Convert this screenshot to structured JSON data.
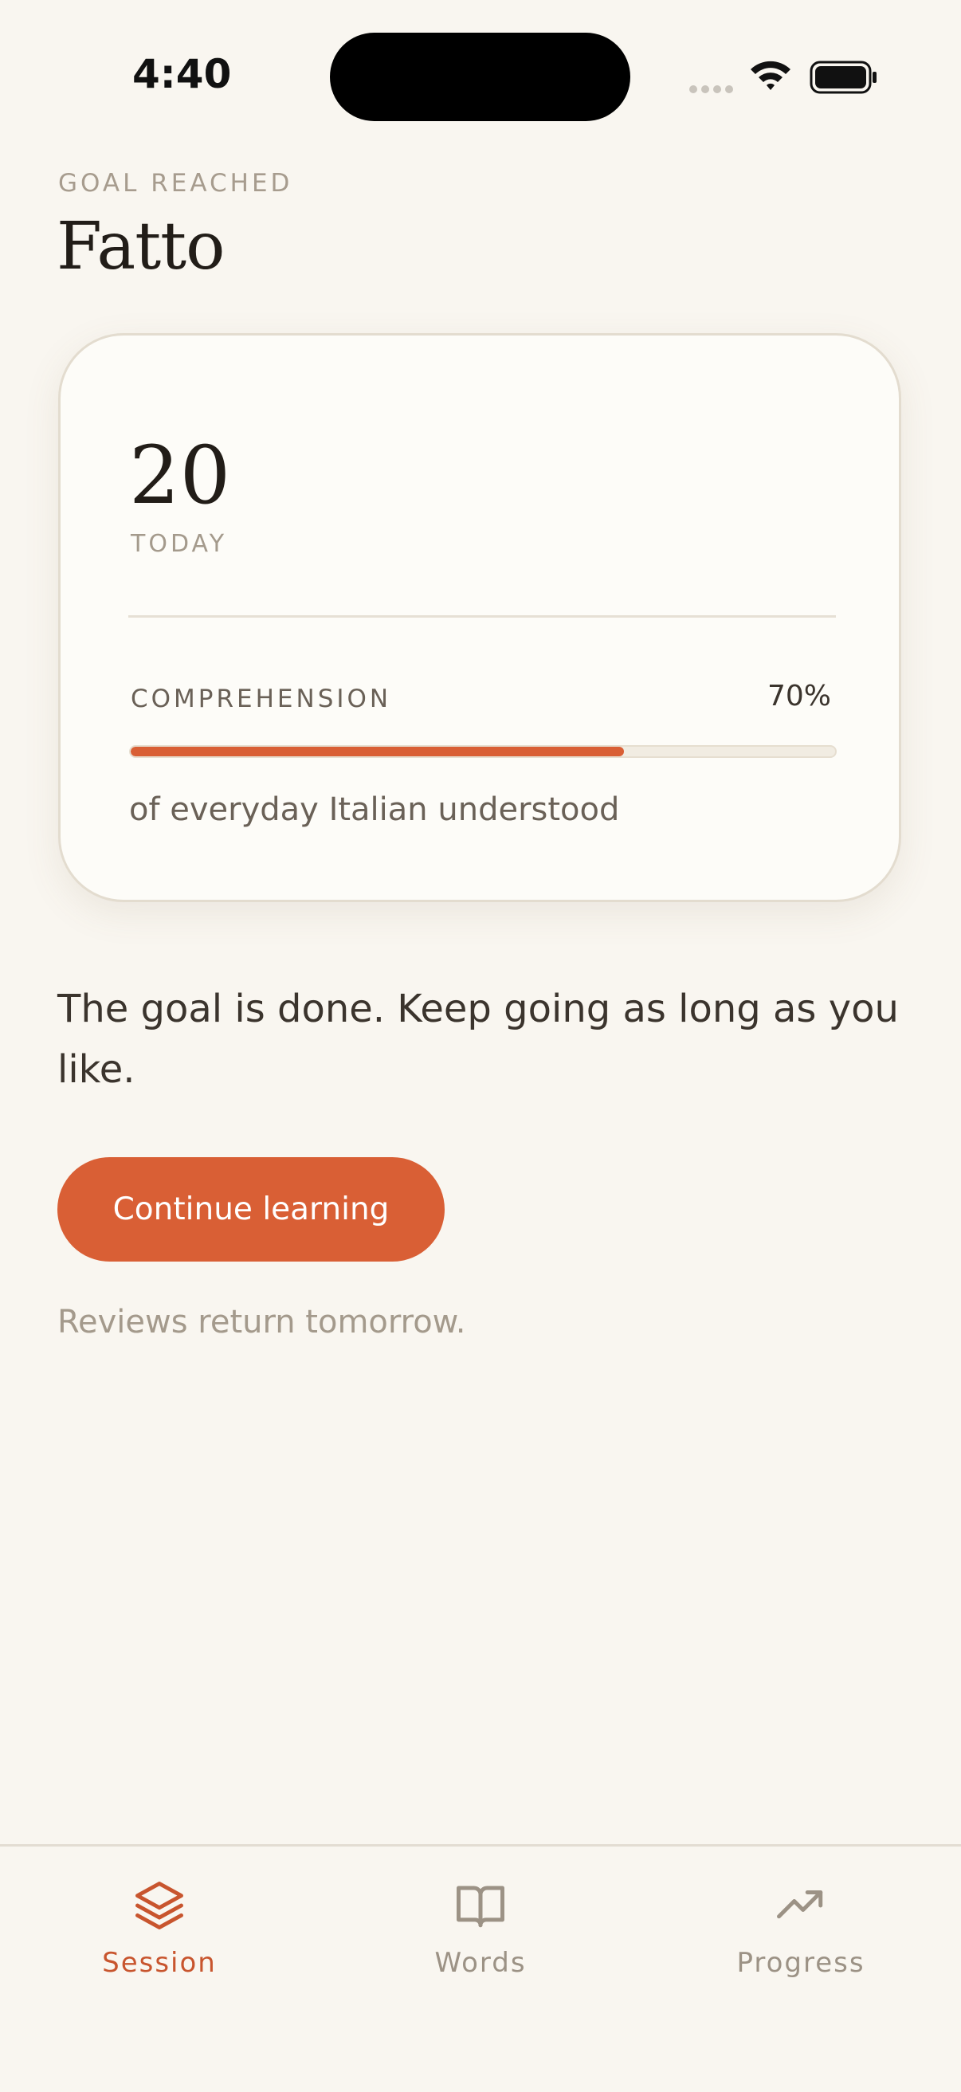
{
  "status_bar": {
    "time": "4:40"
  },
  "header": {
    "eyebrow": "GOAL REACHED",
    "title": "Fatto"
  },
  "card": {
    "count": "20",
    "count_label": "TODAY",
    "comprehension_label": "COMPREHENSION",
    "comprehension_percent": "70%",
    "comprehension_value": 0.7,
    "comprehension_description": "of everyday Italian understood"
  },
  "message": "The goal is done. Keep going as long as you like.",
  "cta": {
    "label": "Continue learning"
  },
  "note": "Reviews return tomorrow.",
  "tabbar": {
    "items": [
      {
        "label": "Session",
        "icon": "layers-icon",
        "active": true
      },
      {
        "label": "Words",
        "icon": "book-icon",
        "active": false
      },
      {
        "label": "Progress",
        "icon": "trending-up-icon",
        "active": false
      }
    ]
  },
  "colors": {
    "accent": "#d95f35",
    "background": "#f9f6f0",
    "card": "#fdfcf8"
  }
}
